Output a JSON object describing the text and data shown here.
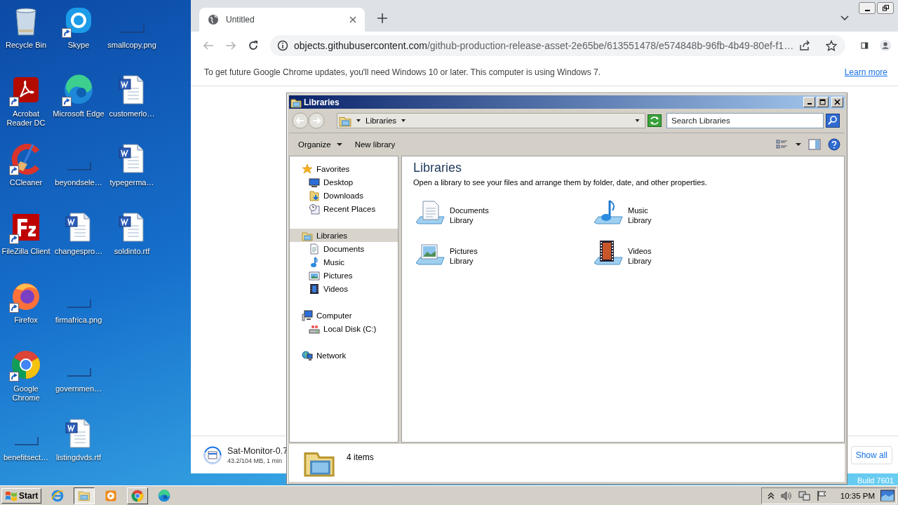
{
  "desktop": {
    "columns": [
      [
        {
          "label": "Recycle Bin",
          "kind": "recycle",
          "shortcut": false
        },
        {
          "label": "Acrobat Reader DC",
          "kind": "acrobat",
          "shortcut": true
        },
        {
          "label": "CCleaner",
          "kind": "ccleaner",
          "shortcut": true
        },
        {
          "label": "FileZilla Client",
          "kind": "filezilla",
          "shortcut": true
        },
        {
          "label": "Firefox",
          "kind": "firefox",
          "shortcut": true
        },
        {
          "label": "Google Chrome",
          "kind": "chrome",
          "shortcut": true
        },
        {
          "label": "benefitsect…",
          "kind": "image",
          "shortcut": false
        }
      ],
      [
        {
          "label": "Skype",
          "kind": "skype",
          "shortcut": true
        },
        {
          "label": "Microsoft Edge",
          "kind": "edge",
          "shortcut": true
        },
        {
          "label": "beyondsele…",
          "kind": "image",
          "shortcut": false
        },
        {
          "label": "changespro…",
          "kind": "word",
          "shortcut": false
        },
        {
          "label": "firmafrica.png",
          "kind": "image",
          "shortcut": false
        },
        {
          "label": "governmen…",
          "kind": "image",
          "shortcut": false
        },
        {
          "label": "listingdvds.rtf",
          "kind": "word",
          "shortcut": false
        }
      ],
      [
        {
          "label": "smallcopy.png",
          "kind": "image",
          "shortcut": false
        },
        {
          "label": "customerlo…",
          "kind": "word",
          "shortcut": false
        },
        {
          "label": "typegerma…",
          "kind": "word",
          "shortcut": false
        },
        {
          "label": "soldinto.rtf",
          "kind": "word",
          "shortcut": false
        }
      ]
    ],
    "build": "Build 7601"
  },
  "browser": {
    "tab": {
      "title": "Untitled"
    },
    "url_host": "objects.githubusercontent.com",
    "url_path": "/github-production-release-asset-2e65be/613551478/e574848b-96fb-4b49-80ef-f1…",
    "infobar": {
      "message": "To get future Google Chrome updates, you'll need Windows 10 or later. This computer is using Windows 7.",
      "link": "Learn more"
    },
    "download": {
      "name": "Sat-Monitor-0.7",
      "status": "43.2/104 MB, 1 min"
    },
    "show_all": "Show all"
  },
  "explorer": {
    "title": "Libraries",
    "breadcrumb": "Libraries",
    "search": {
      "placeholder": "Search Libraries"
    },
    "toolbar": [
      {
        "label": "Organize",
        "menu": true
      },
      {
        "label": "New library",
        "menu": false
      }
    ],
    "nav": [
      {
        "label": "Favorites",
        "kind": "star",
        "selected": false,
        "children": [
          {
            "label": "Desktop",
            "kind": "desktop",
            "selected": false
          },
          {
            "label": "Downloads",
            "kind": "downloads",
            "selected": false
          },
          {
            "label": "Recent Places",
            "kind": "recent",
            "selected": false
          }
        ]
      },
      {
        "label": "Libraries",
        "kind": "library",
        "selected": true,
        "children": [
          {
            "label": "Documents",
            "kind": "documents",
            "selected": false
          },
          {
            "label": "Music",
            "kind": "music",
            "selected": false
          },
          {
            "label": "Pictures",
            "kind": "pictures",
            "selected": false
          },
          {
            "label": "Videos",
            "kind": "videos",
            "selected": false
          }
        ]
      },
      {
        "label": "Computer",
        "kind": "computer",
        "selected": false,
        "children": [
          {
            "label": "Local Disk (C:)",
            "kind": "disk",
            "selected": false
          }
        ]
      },
      {
        "label": "Network",
        "kind": "network",
        "selected": false
      }
    ],
    "heading": "Libraries",
    "description": "Open a library to see your files and arrange them by folder, date, and other properties.",
    "libraries": [
      {
        "name": "Documents",
        "subtitle": "Library",
        "kind": "documents"
      },
      {
        "name": "Music",
        "subtitle": "Library",
        "kind": "music"
      },
      {
        "name": "Pictures",
        "subtitle": "Library",
        "kind": "pictures"
      },
      {
        "name": "Videos",
        "subtitle": "Library",
        "kind": "videos"
      }
    ],
    "status": "4 items"
  },
  "taskbar": {
    "start": "Start",
    "apps": [
      {
        "kind": "ie",
        "open": false,
        "selected": false
      },
      {
        "kind": "explorer",
        "open": true,
        "selected": true
      },
      {
        "kind": "media",
        "open": false,
        "selected": false
      },
      {
        "kind": "chrome",
        "open": true,
        "selected": false
      },
      {
        "kind": "edge",
        "open": false,
        "selected": false
      }
    ],
    "clock": "10:35 PM"
  }
}
